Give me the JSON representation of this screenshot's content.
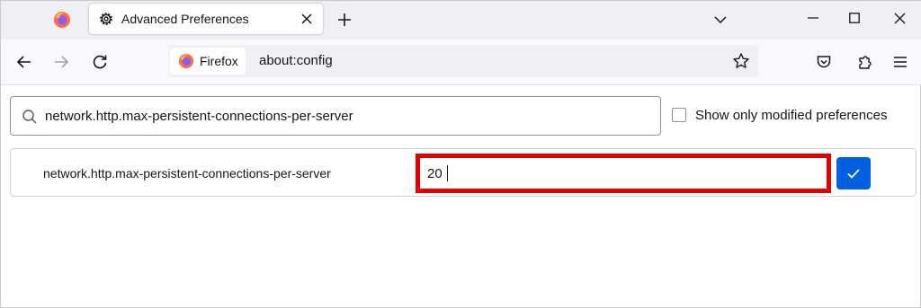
{
  "tabs": {
    "active_title": "Advanced Preferences"
  },
  "urlbar": {
    "identity_label": "Firefox",
    "url": "about:config"
  },
  "search": {
    "value": "network.http.max-persistent-connections-per-server",
    "placeholder": ""
  },
  "filter": {
    "show_modified_label": "Show only modified preferences",
    "checked": false
  },
  "preference": {
    "name": "network.http.max-persistent-connections-per-server",
    "value": "20"
  },
  "colors": {
    "accent": "#0060df",
    "highlight": "#e00000",
    "firefox_orange": "#ff7139",
    "firefox_purple": "#9059ff"
  },
  "icons": {
    "pinned_tab": "firefox-logo-icon",
    "tab": "gear-icon",
    "close": "close-icon",
    "new_tab": "plus-icon",
    "list_tabs": "chevron-down-icon",
    "back": "back-arrow-icon",
    "forward": "forward-arrow-icon",
    "reload": "reload-icon",
    "bookmark": "star-icon",
    "pocket": "pocket-icon",
    "extensions": "puzzle-icon",
    "menu": "hamburger-menu-icon",
    "search": "search-icon",
    "save": "checkmark-icon"
  }
}
